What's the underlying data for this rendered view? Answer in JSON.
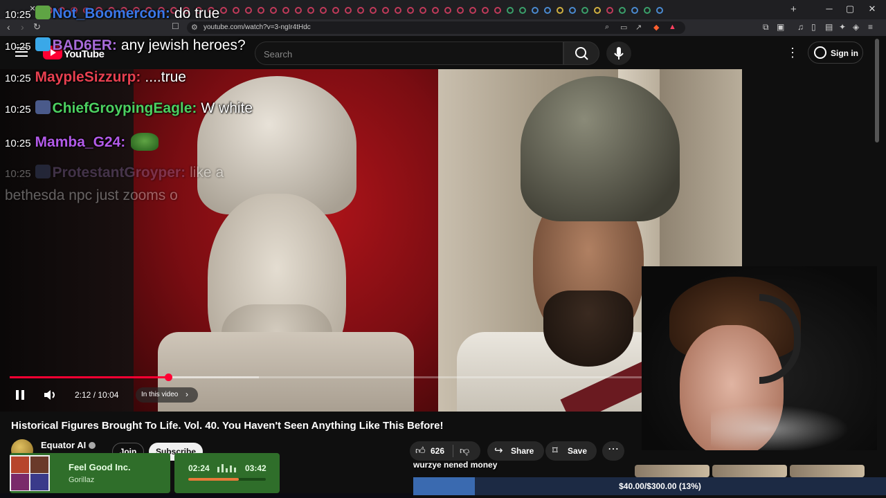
{
  "browser": {
    "url": "youtube.com/watch?v=3-ngIr4tHdc"
  },
  "youtube": {
    "logo_text": "YouTube",
    "search_placeholder": "Search",
    "sign_in_label": "Sign in"
  },
  "chat": {
    "messages": [
      {
        "time": "10:25",
        "user": "Not_Boomercon:",
        "user_color": "#3a78e8",
        "message": "do true"
      },
      {
        "time": "10:25",
        "user": "BAD6ER:",
        "user_color": "#a86bd8",
        "message": "any jewish heroes?"
      },
      {
        "time": "10:25",
        "user": "MaypleSizzurp:",
        "user_color": "#e84050",
        "message": "....true"
      },
      {
        "time": "10:25",
        "user": "ChiefGroypingEagle:",
        "user_color": "#4cd060",
        "message": "W white"
      },
      {
        "time": "10:25",
        "user": "Mamba_G24:",
        "user_color": "#b25ae8",
        "message": ""
      },
      {
        "time": "10:25",
        "user": "ProtestantGroyper:",
        "user_color": "#9a7ab8",
        "message": "like a"
      },
      {
        "time": "",
        "user": "",
        "user_color": "#ffffff",
        "message": "bethesda npc just zooms o"
      }
    ]
  },
  "player": {
    "time_display": "2:12 / 10:04",
    "progress_fraction": 0.2185,
    "chapter_label": "In this video"
  },
  "video": {
    "title": "Historical Figures Brought To Life. Vol. 40. You Haven't Seen Anything Like This Before!",
    "channel_name": "Equator AI",
    "join_label": "Join",
    "subscribe_label": "Subscribe",
    "like_count": "626",
    "share_label": "Share",
    "save_label": "Save"
  },
  "stream_overlay": {
    "song_title": "Feel Good Inc.",
    "song_artist": "Gorillaz",
    "song_elapsed": "02:24",
    "song_total": "03:42",
    "song_progress_fraction": 0.65,
    "donation_text": "wurzye nened money",
    "goal_label": "$40.00/$300.00 (13%)",
    "goal_fraction": 0.13
  },
  "colors": {
    "accent_red": "#ff0033",
    "song_card_green": "#2f6e2a",
    "goal_blue": "#3a6ab0"
  }
}
